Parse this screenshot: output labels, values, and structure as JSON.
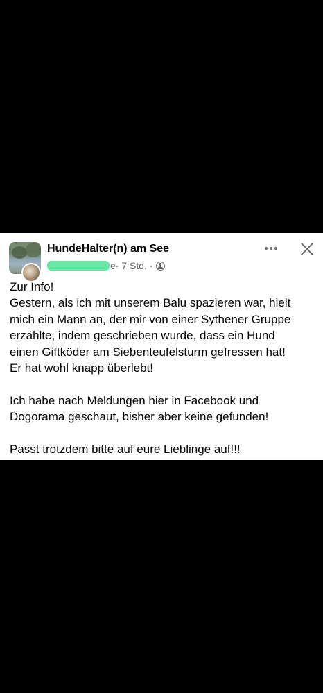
{
  "post": {
    "group_name": "HundeHalter(n) am See",
    "author_suffix": "e",
    "time": "· 7 Std. ·",
    "privacy_icon": "globe-icon",
    "more_icon": "more-options-icon",
    "close_icon": "close-icon",
    "body": {
      "line1": "Zur Info!",
      "line2": "Gestern, als ich mit unserem Balu spazieren war, hielt",
      "line3": "mich ein Mann an, der mir von einer Sythener Gruppe",
      "line4": "erzählte, indem geschrieben wurde, dass ein Hund",
      "line5": "einen Giftköder am Siebenteufelsturm gefressen hat!",
      "line6": "Er hat wohl knapp überlebt!",
      "line7": "Ich habe nach Meldungen hier in Facebook und",
      "line8": "Dogorama geschaut, bisher aber keine gefunden!",
      "line9": "Passt trotzdem bitte auf eure Lieblinge auf!!!"
    }
  },
  "colors": {
    "background": "#000000",
    "card": "#ffffff",
    "text": "#050505",
    "secondary_text": "#65676b",
    "redaction": "#57e39a"
  }
}
